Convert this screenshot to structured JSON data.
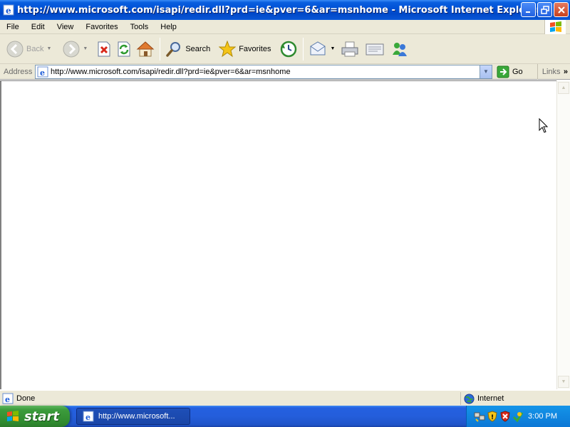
{
  "window": {
    "title": "http://www.microsoft.com/isapi/redir.dll?prd=ie&pver=6&ar=msnhome - Microsoft Internet Explorer",
    "buttons": [
      "minimize-icon",
      "maximize-icon",
      "close-icon"
    ]
  },
  "menu": {
    "items": [
      "File",
      "Edit",
      "View",
      "Favorites",
      "Tools",
      "Help"
    ]
  },
  "toolbar": {
    "back_label": "Back",
    "search_label": "Search",
    "favorites_label": "Favorites"
  },
  "address": {
    "label": "Address",
    "url": "http://www.microsoft.com/isapi/redir.dll?prd=ie&pver=6&ar=msnhome",
    "go_label": "Go",
    "links_label": "Links",
    "links_more": "»"
  },
  "status": {
    "text": "Done",
    "zone": "Internet"
  },
  "taskbar": {
    "start_label": "start",
    "task_label": "http://www.microsoft...",
    "clock": "3:00 PM"
  },
  "colors": {
    "titlebar": "#0052d6",
    "chrome": "#ece9d8",
    "taskbar": "#245edb",
    "start": "#3c9c3c"
  }
}
